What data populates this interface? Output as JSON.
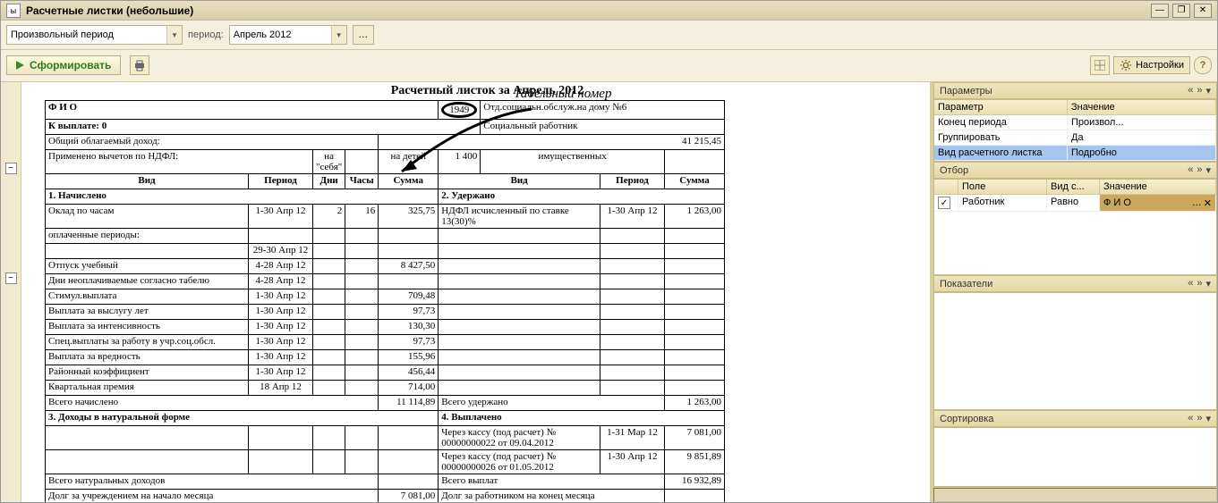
{
  "window": {
    "title": "Расчетные листки (небольшие)"
  },
  "toolbar": {
    "mode": "Произвольный период",
    "period_label": "период:",
    "period_value": "Апрель 2012",
    "form_button": "Сформировать",
    "settings_label": "Настройки"
  },
  "annotation": {
    "text": "Табельный номер"
  },
  "report": {
    "title": "Расчетный листок за Апрель 2012",
    "header": {
      "fio_label": "Ф И О",
      "emp_number": "1949",
      "dept": "Отд.социальн.обслуж.на дому №6",
      "topay_label": "К выплате:",
      "topay_value": "0",
      "position": "Социальный работник",
      "income_label": "Общий облагаемый доход:",
      "income_value": "41 215,45",
      "ded_lbl": "Применено вычетов по НДФЛ:",
      "ded_self_lbl": "на \"себя\"",
      "ded_self_val": "",
      "ded_child_lbl": "на детей",
      "ded_child_val": "1 400",
      "ded_prop_lbl": "имущественных",
      "ded_prop_val": ""
    },
    "cols": {
      "vid": "Вид",
      "period": "Период",
      "dni": "Дни",
      "chasy": "Часы",
      "summa": "Сумма"
    },
    "sections": {
      "accrued": "1. Начислено",
      "withheld": "2. Удержано",
      "natural": "3. Доходы в натуральной форме",
      "paid": "4. Выплачено"
    },
    "accrued": [
      {
        "name": "Оклад по часам",
        "period": "1-30 Апр 12",
        "days": "2",
        "hours": "16",
        "sum": "325,75"
      },
      {
        "name": "оплаченные периоды:",
        "period": "",
        "days": "",
        "hours": "",
        "sum": ""
      },
      {
        "name": "",
        "period": "29-30 Апр 12",
        "days": "",
        "hours": "",
        "sum": ""
      },
      {
        "name": "Отпуск учебный",
        "period": "4-28 Апр 12",
        "days": "",
        "hours": "",
        "sum": "8 427,50"
      },
      {
        "name": "Дни неоплачиваемые согласно табелю",
        "period": "4-28 Апр 12",
        "days": "",
        "hours": "",
        "sum": ""
      },
      {
        "name": "Стимул.выплата",
        "period": "1-30 Апр 12",
        "days": "",
        "hours": "",
        "sum": "709,48"
      },
      {
        "name": "Выплата за выслугу лет",
        "period": "1-30 Апр 12",
        "days": "",
        "hours": "",
        "sum": "97,73"
      },
      {
        "name": "Выплата за интенсивность",
        "period": "1-30 Апр 12",
        "days": "",
        "hours": "",
        "sum": "130,30"
      },
      {
        "name": "Спец.выплаты за работу в учр.соц.обсл.",
        "period": "1-30 Апр 12",
        "days": "",
        "hours": "",
        "sum": "97,73"
      },
      {
        "name": "Выплата за вредность",
        "period": "1-30 Апр 12",
        "days": "",
        "hours": "",
        "sum": "155,96"
      },
      {
        "name": "Районный коэффициент",
        "period": "1-30 Апр 12",
        "days": "",
        "hours": "",
        "sum": "456,44"
      },
      {
        "name": "Квартальная премия",
        "period": "18 Апр 12",
        "days": "",
        "hours": "",
        "sum": "714,00"
      }
    ],
    "accrued_total_lbl": "Всего начислено",
    "accrued_total_val": "11 114,89",
    "withheld": [
      {
        "name": "НДФЛ исчисленный по ставке 13(30)%",
        "period": "1-30 Апр 12",
        "sum": "1 263,00"
      }
    ],
    "withheld_total_lbl": "Всего удержано",
    "withheld_total_val": "1 263,00",
    "paid": [
      {
        "name": "Через кассу (под расчет) № 00000000022 от 09.04.2012",
        "period": "1-31 Мар 12",
        "sum": "7 081,00"
      },
      {
        "name": "Через кассу (под расчет) № 00000000026 от 01.05.2012",
        "period": "1-30 Апр 12",
        "sum": "9 851,89"
      }
    ],
    "nat_total_lbl": "Всего натуральных доходов",
    "paid_total_lbl": "Всего выплат",
    "paid_total_val": "16 932,89",
    "debt_org_lbl": "Долг за учреждением на начало месяца",
    "debt_org_val": "7 081,00",
    "debt_emp_lbl": "Долг за работником на конец месяца"
  },
  "side": {
    "params_title": "Параметры",
    "params_cols": {
      "p": "Параметр",
      "v": "Значение"
    },
    "params_rows": [
      {
        "p": "Конец периода",
        "v": "Произвол..."
      },
      {
        "p": "Группировать",
        "v": "Да"
      },
      {
        "p": "Вид расчетного листка",
        "v": "Подробно"
      }
    ],
    "filter_title": "Отбор",
    "filter_cols": {
      "f": "Поле",
      "c": "Вид с...",
      "v": "Значение"
    },
    "filter_row": {
      "checked": "✓",
      "field": "Работник",
      "cond": "Равно",
      "val": "Ф И О"
    },
    "indicators_title": "Показатели",
    "sort_title": "Сортировка"
  }
}
